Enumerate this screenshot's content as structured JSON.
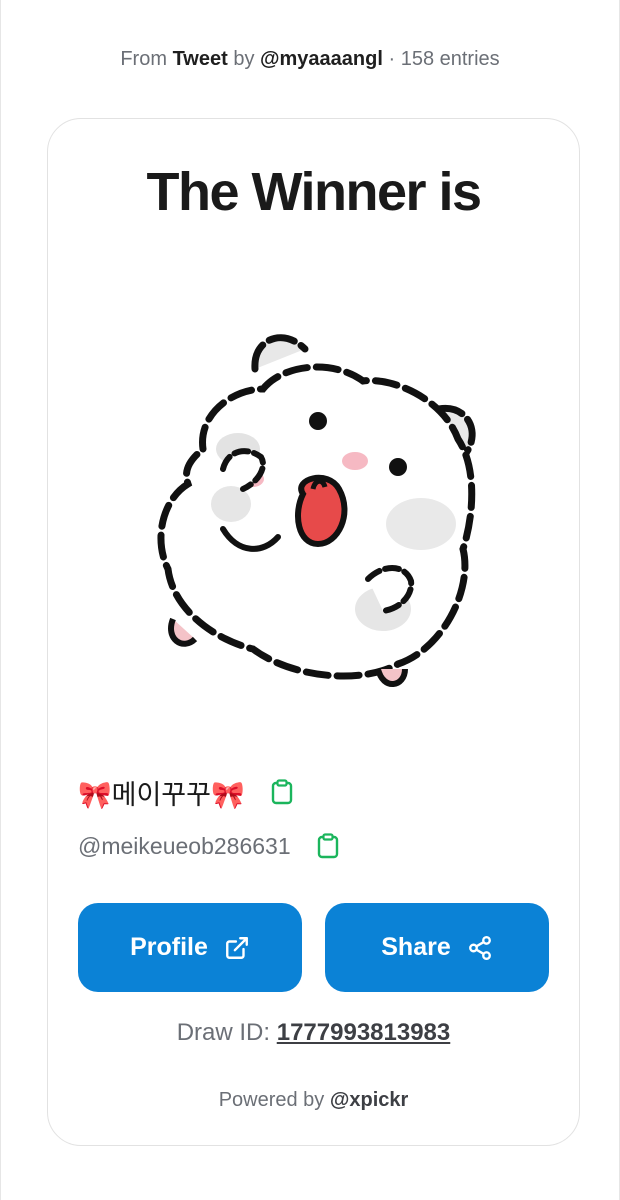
{
  "header": {
    "prefix": "From",
    "source": "Tweet",
    "by_text": "by",
    "author": "@myaaaangl",
    "separator": "·",
    "entries": "158 entries"
  },
  "card": {
    "title": "The Winner is",
    "winner": {
      "display_name": "🎀메이꾸꾸🎀",
      "handle": "@meikeueob286631",
      "avatar_icon": "hamster-illustration"
    },
    "buttons": {
      "profile_label": "Profile",
      "profile_icon": "external-link-icon",
      "share_label": "Share",
      "share_icon": "share-icon"
    },
    "draw_id_label": "Draw ID:",
    "draw_id": "1777993813983",
    "powered_prefix": "Powered by",
    "powered_brand": "@xpickr"
  },
  "colors": {
    "accent": "#0b82d6",
    "copy_icon": "#1bb55c",
    "muted_text": "#6b6f76"
  }
}
